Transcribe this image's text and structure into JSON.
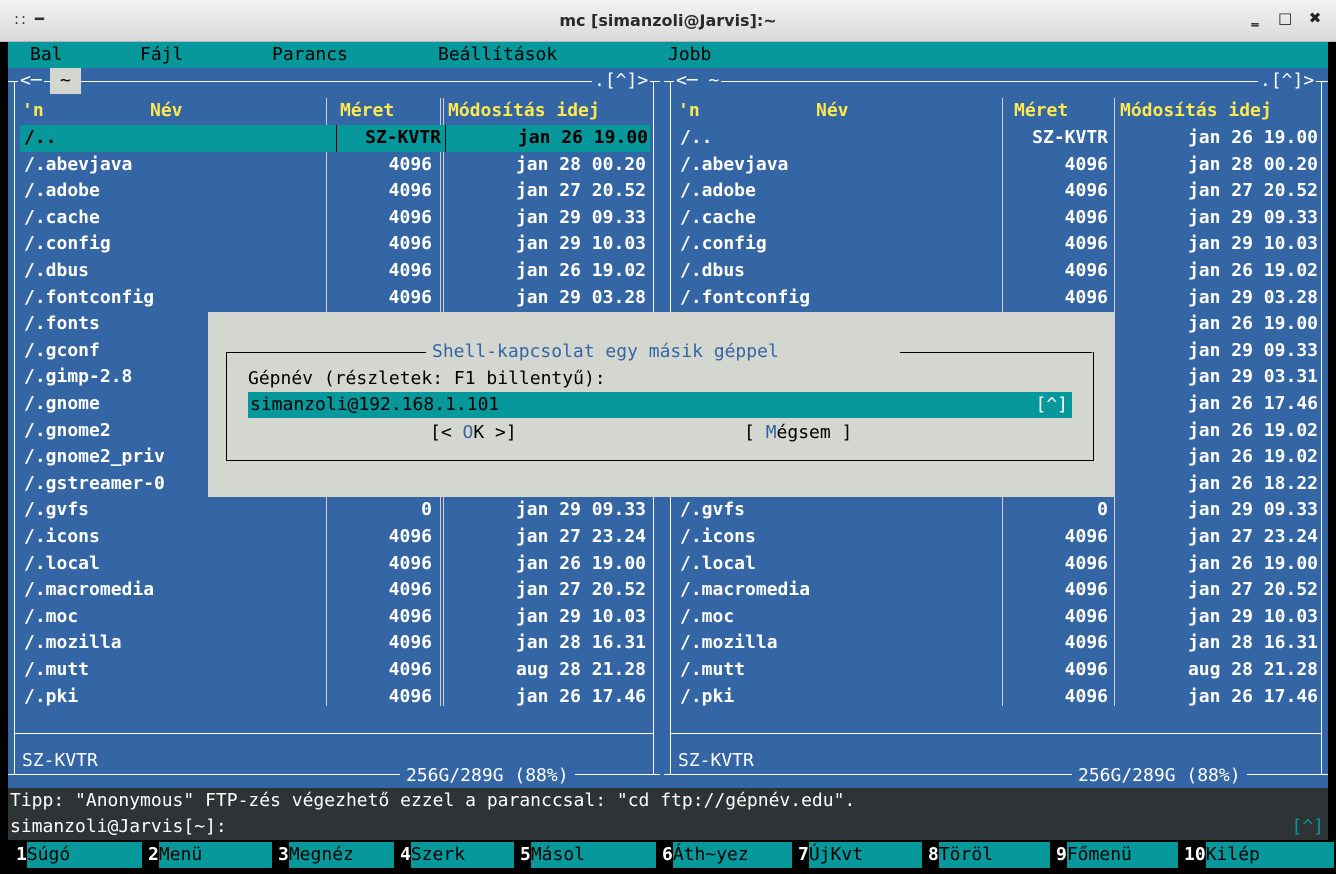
{
  "window": {
    "left_glyphs": ":: ━",
    "title": "mc [simanzoli@Jarvis]:~",
    "minimize": "‗",
    "maximize": "□",
    "close": "✖"
  },
  "menu": [
    "Bal",
    "Fájl",
    "Parancs",
    "Beállítások",
    "Jobb"
  ],
  "left_panel": {
    "nav_left": "<─",
    "path_tag": "~",
    "nav_right": ".[^]>",
    "headers": {
      "n": "'n",
      "name": "Név",
      "size": "Méret",
      "mtime": "Módosítás idej"
    },
    "selected": {
      "name": "/..",
      "size": "SZ-KVTR",
      "mtime": "jan 26 19.00"
    },
    "files": [
      {
        "name": "/.abevjava",
        "size": "4096",
        "mtime": "jan 28 00.20"
      },
      {
        "name": "/.adobe",
        "size": "4096",
        "mtime": "jan 27 20.52"
      },
      {
        "name": "/.cache",
        "size": "4096",
        "mtime": "jan 29 09.33"
      },
      {
        "name": "/.config",
        "size": "4096",
        "mtime": "jan 29 10.03"
      },
      {
        "name": "/.dbus",
        "size": "4096",
        "mtime": "jan 26 19.02"
      },
      {
        "name": "/.fontconfig",
        "size": "4096",
        "mtime": "jan 29 03.28"
      },
      {
        "name": "/.fonts",
        "size": "",
        "mtime": ""
      },
      {
        "name": "/.gconf",
        "size": "",
        "mtime": ""
      },
      {
        "name": "/.gimp-2.8",
        "size": "",
        "mtime": ""
      },
      {
        "name": "/.gnome",
        "size": "",
        "mtime": ""
      },
      {
        "name": "/.gnome2",
        "size": "",
        "mtime": ""
      },
      {
        "name": "/.gnome2_priv",
        "size": "",
        "mtime": ""
      },
      {
        "name": "/.gstreamer-0",
        "size": "",
        "mtime": ""
      },
      {
        "name": "/.gvfs",
        "size": "0",
        "mtime": "jan 29 09.33"
      },
      {
        "name": "/.icons",
        "size": "4096",
        "mtime": "jan 27 23.24"
      },
      {
        "name": "/.local",
        "size": "4096",
        "mtime": "jan 26 19.00"
      },
      {
        "name": "/.macromedia",
        "size": "4096",
        "mtime": "jan 27 20.52"
      },
      {
        "name": "/.moc",
        "size": "4096",
        "mtime": "jan 29 10.03"
      },
      {
        "name": "/.mozilla",
        "size": "4096",
        "mtime": "jan 28 16.31"
      },
      {
        "name": "/.mutt",
        "size": "4096",
        "mtime": "aug 28 21.28"
      },
      {
        "name": "/.pki",
        "size": "4096",
        "mtime": "jan 26 17.46"
      }
    ],
    "mini_status": "SZ-KVTR",
    "disk": "256G/289G (88%)"
  },
  "right_panel": {
    "nav_left": "<─ ~",
    "nav_right": ".[^]>",
    "headers": {
      "n": "'n",
      "name": "Név",
      "size": "Méret",
      "mtime": "Módosítás idej"
    },
    "files": [
      {
        "name": "/..",
        "size": "SZ-KVTR",
        "mtime": "jan 26 19.00"
      },
      {
        "name": "/.abevjava",
        "size": "4096",
        "mtime": "jan 28 00.20"
      },
      {
        "name": "/.adobe",
        "size": "4096",
        "mtime": "jan 27 20.52"
      },
      {
        "name": "/.cache",
        "size": "4096",
        "mtime": "jan 29 09.33"
      },
      {
        "name": "/.config",
        "size": "4096",
        "mtime": "jan 29 10.03"
      },
      {
        "name": "/.dbus",
        "size": "4096",
        "mtime": "jan 26 19.02"
      },
      {
        "name": "/.fontconfig",
        "size": "4096",
        "mtime": "jan 29 03.28"
      },
      {
        "name": "",
        "size": "",
        "mtime": "jan 26 19.00"
      },
      {
        "name": "",
        "size": "",
        "mtime": "jan 29 09.33"
      },
      {
        "name": "",
        "size": "",
        "mtime": "jan 29 03.31"
      },
      {
        "name": "",
        "size": "",
        "mtime": "jan 26 17.46"
      },
      {
        "name": "",
        "size": "",
        "mtime": "jan 26 19.02"
      },
      {
        "name": "",
        "size": "",
        "mtime": "jan 26 19.02"
      },
      {
        "name": "",
        "size": "",
        "mtime": "jan 26 18.22"
      },
      {
        "name": "/.gvfs",
        "size": "0",
        "mtime": "jan 29 09.33"
      },
      {
        "name": "/.icons",
        "size": "4096",
        "mtime": "jan 27 23.24"
      },
      {
        "name": "/.local",
        "size": "4096",
        "mtime": "jan 26 19.00"
      },
      {
        "name": "/.macromedia",
        "size": "4096",
        "mtime": "jan 27 20.52"
      },
      {
        "name": "/.moc",
        "size": "4096",
        "mtime": "jan 29 10.03"
      },
      {
        "name": "/.mozilla",
        "size": "4096",
        "mtime": "jan 28 16.31"
      },
      {
        "name": "/.mutt",
        "size": "4096",
        "mtime": "aug 28 21.28"
      },
      {
        "name": "/.pki",
        "size": "4096",
        "mtime": "jan 26 17.46"
      }
    ],
    "mini_status": "SZ-KVTR",
    "disk": "256G/289G (88%)"
  },
  "dialog": {
    "title": " Shell-kapcsolat egy másik géppel ",
    "label": "Gépnév (részletek: F1 billentyű):",
    "input_value": "simanzoli@192.168.1.101",
    "history": "[^]",
    "ok_prefix": "[< ",
    "ok_hot": "O",
    "ok_rest": "K >]",
    "cancel_prefix": "[ ",
    "cancel_hot": "M",
    "cancel_rest": "égsem ]"
  },
  "tip": "Tipp: \"Anonymous\" FTP-zés végezhető ezzel a paranccsal: \"cd ftp://gépnév.edu\".",
  "prompt": "simanzoli@Jarvis[~]:",
  "prompt_hist": "[^]",
  "fkeys": [
    {
      "num": "1",
      "label": "Súgó"
    },
    {
      "num": "2",
      "label": "Menü"
    },
    {
      "num": "3",
      "label": "Megnéz"
    },
    {
      "num": "4",
      "label": "Szerk"
    },
    {
      "num": "5",
      "label": "Másol"
    },
    {
      "num": "6",
      "label": "Áth~yez"
    },
    {
      "num": "7",
      "label": "ÚjKvt"
    },
    {
      "num": "8",
      "label": "Töröl"
    },
    {
      "num": "9",
      "label": "Főmenü"
    },
    {
      "num": "10",
      "label": "Kilép"
    }
  ],
  "colors": {
    "panel_bg": "#3465a4",
    "cyan": "#06989a",
    "header_yellow": "#fce94f",
    "dialog_bg": "#d3d7cf"
  }
}
